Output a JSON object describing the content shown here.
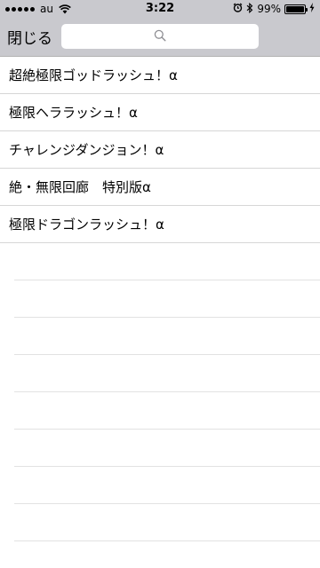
{
  "status_bar": {
    "carrier": "au",
    "time": "3:22",
    "battery_percent": "99%",
    "battery_level": 0.99,
    "icons": [
      "signal-icon",
      "wifi-icon",
      "alarm-icon",
      "bluetooth-icon",
      "battery-icon",
      "charging-icon"
    ]
  },
  "nav": {
    "close_label": "閉じる",
    "search_placeholder": "",
    "search_icon": "search-icon"
  },
  "list": {
    "items": [
      {
        "label": "超絶極限ゴッドラッシュ！α"
      },
      {
        "label": "極限ヘララッシュ！α"
      },
      {
        "label": "チャレンジダンジョン！α"
      },
      {
        "label": "絶・無限回廊　特別版α"
      },
      {
        "label": "極限ドラゴンラッシュ！α"
      }
    ]
  }
}
